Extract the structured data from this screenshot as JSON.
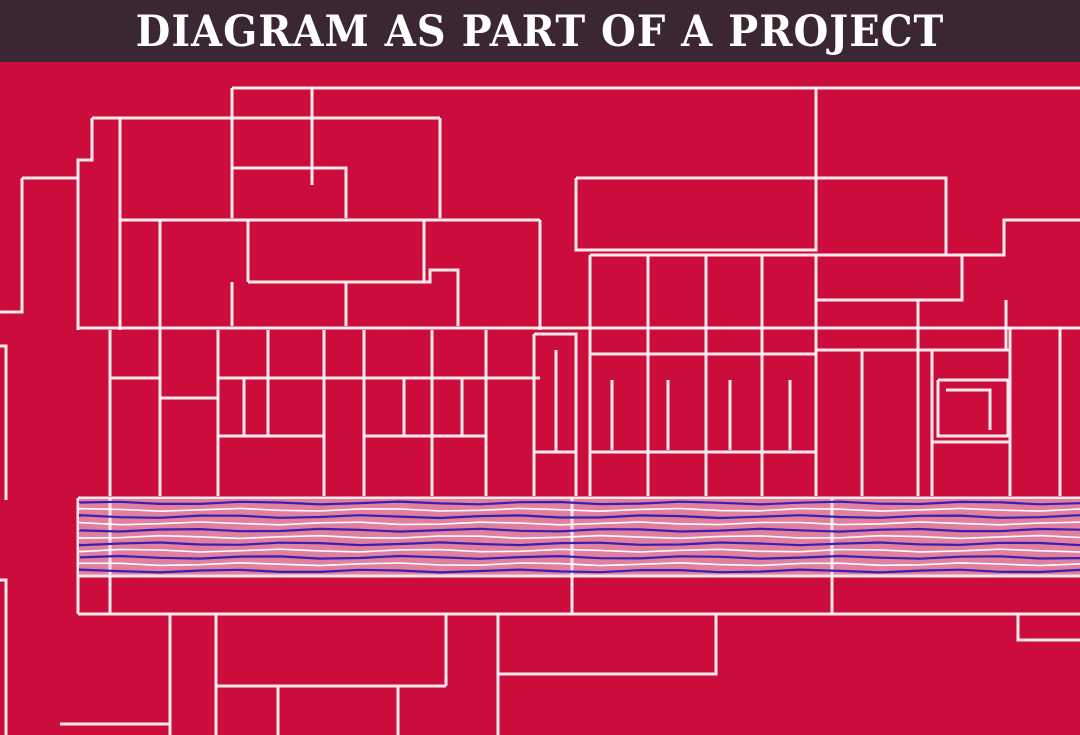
{
  "header": {
    "title": "DIAGRAM AS PART OF A PROJECT"
  },
  "colors": {
    "header_bg": "#3b2733",
    "canvas_bg": "#cc0d3c",
    "line": "#fbe9ee",
    "band_line": "#3a1fb0"
  },
  "illustration": {
    "name": "red-floorplan-diagram"
  }
}
